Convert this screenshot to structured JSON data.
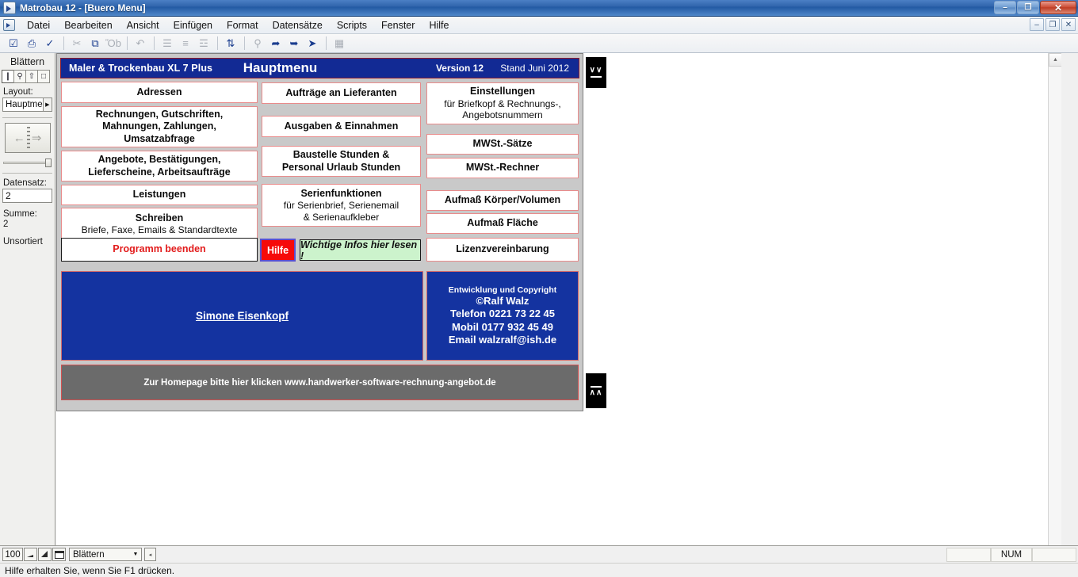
{
  "window": {
    "title": "Matrobau 12 - [Buero Menu]",
    "icon": "app-icon",
    "controls": [
      {
        "name": "minimize",
        "glyph": "–"
      },
      {
        "name": "restore",
        "glyph": "❐"
      },
      {
        "name": "close",
        "glyph": "✕"
      }
    ],
    "mdi_controls": [
      {
        "name": "mdi-minimize",
        "glyph": "–"
      },
      {
        "name": "mdi-restore",
        "glyph": "❐"
      },
      {
        "name": "mdi-close",
        "glyph": "✕"
      }
    ]
  },
  "menu": {
    "items": [
      {
        "label": "Datei"
      },
      {
        "label": "Bearbeiten"
      },
      {
        "label": "Ansicht"
      },
      {
        "label": "Einfügen"
      },
      {
        "label": "Format"
      },
      {
        "label": "Datensätze"
      },
      {
        "label": "Scripts"
      },
      {
        "label": "Fenster"
      },
      {
        "label": "Hilfe"
      }
    ]
  },
  "toolbar": {
    "buttons": [
      {
        "name": "new-record-icon",
        "glyph": "☑",
        "dim": false
      },
      {
        "name": "print-icon",
        "glyph": "⎙",
        "dim": false
      },
      {
        "name": "spellcheck-icon",
        "glyph": "✓",
        "dim": false
      },
      {
        "name": "cut-icon",
        "glyph": "✂",
        "dim": true
      },
      {
        "name": "copy-icon",
        "glyph": "⧉",
        "dim": false
      },
      {
        "name": "paste-icon",
        "glyph": "Ὄb",
        "dim": true
      },
      {
        "name": "undo-icon",
        "glyph": "↶",
        "dim": true
      },
      {
        "name": "find-all-icon",
        "glyph": "☰",
        "dim": true
      },
      {
        "name": "omit-record-icon",
        "glyph": "≡",
        "dim": true
      },
      {
        "name": "show-all-icon",
        "glyph": "☲",
        "dim": true
      },
      {
        "name": "sort-icon",
        "glyph": "⇅",
        "dim": false
      },
      {
        "name": "find-icon",
        "glyph": "⚲",
        "dim": true
      },
      {
        "name": "import-icon",
        "glyph": "➦",
        "dim": false
      },
      {
        "name": "export-icon",
        "glyph": "➥",
        "dim": false
      },
      {
        "name": "preview-icon",
        "glyph": "➤",
        "dim": false
      },
      {
        "name": "script-icon",
        "glyph": "▦",
        "dim": true
      }
    ]
  },
  "sidebar": {
    "title": "Blättern",
    "mode_buttons": [
      {
        "name": "browse-mode",
        "glyph": "❙",
        "active": true
      },
      {
        "name": "find-mode",
        "glyph": "⚲",
        "active": false
      },
      {
        "name": "preview-mode",
        "glyph": "⇧",
        "active": false
      },
      {
        "name": "layout-mode",
        "glyph": "□",
        "active": false
      }
    ],
    "layout_label": "Layout:",
    "layout_value": "Hauptme",
    "book": {
      "prev": "←",
      "next": "⇒"
    },
    "record_label": "Datensatz:",
    "record_value": "2",
    "total_label": "Summe:",
    "total_value": "2",
    "sort_state": "Unsortiert"
  },
  "layout": {
    "header": {
      "product": "Maler & Trockenbau XL 7 Plus",
      "title": "Hauptmenu",
      "version": "Version 12",
      "date": "Stand Juni 2012"
    },
    "left_buttons": [
      {
        "l1": "Adressen",
        "l2": ""
      },
      {
        "l1": "Rechnungen, Gutschriften,",
        "l2": "Mahnungen, Zahlungen,",
        "l3": "Umsatzabfrage",
        "multiline_bold": true
      },
      {
        "l1": "Angebote, Bestätigungen,",
        "l2": "Lieferscheine, Arbeitsaufträge",
        "multiline_bold": true
      },
      {
        "l1": "Leistungen",
        "l2": ""
      },
      {
        "l1": "Schreiben",
        "l2": "Briefe, Faxe, Emails & Standardtexte"
      }
    ],
    "exit_button": "Programm beenden",
    "middle_buttons": [
      {
        "l1": "Aufträge an Lieferanten",
        "l2": ""
      },
      {
        "l1": "Ausgaben & Einnahmen",
        "l2": ""
      },
      {
        "l1": "Baustelle Stunden &",
        "l2": "Personal Urlaub Stunden",
        "multiline_bold": true
      },
      {
        "l1": "Serienfunktionen",
        "l2": "für Serienbrief, Serienemail",
        "l3": "& Serienaufkleber"
      }
    ],
    "help_button": "Hilfe",
    "info_button": "Wichtige Infos hier lesen !",
    "right_buttons": [
      {
        "l1": "Einstellungen",
        "l2": "für Briefkopf & Rechnungs-,",
        "l3": "Angebotsnummern"
      },
      {
        "l1": "MWSt.-Sätze",
        "l2": ""
      },
      {
        "l1": "MWSt.-Rechner",
        "l2": ""
      },
      {
        "l1": "Aufmaß Körper/Volumen",
        "l2": ""
      },
      {
        "l1": "Aufmaß Fläche",
        "l2": ""
      },
      {
        "l1": "Lizenzvereinbarung",
        "l2": ""
      }
    ],
    "user_name": "Simone Eisenkopf",
    "developer": {
      "caption": "Entwicklung und Copyright",
      "lines": [
        "©Ralf Walz",
        "Telefon 0221 73 22 45",
        "Mobil 0177 932 45 49",
        "Email walzralf@ish.de"
      ]
    },
    "homepage_bar": "Zur Homepage bitte hier klicken www.handwerker-software-rechnung-angebot.de",
    "nav_chips": [
      {
        "name": "scroll-down-chip",
        "glyph": "∨∨",
        "bar_position": "below"
      },
      {
        "name": "scroll-up-chip",
        "glyph": "∧∧",
        "bar_position": "above"
      }
    ]
  },
  "statusbar": {
    "zoom": "100",
    "zoom_out_icon": "zoom-out-icon",
    "zoom_in_icon": "zoom-in-icon",
    "toggle_window_icon": "toggle-window-icon",
    "mode": "Blättern",
    "scroll_left_glyph": "◂",
    "cells": [
      "",
      "NUM",
      ""
    ],
    "message": "Hilfe erhalten Sie, wenn Sie F1 drücken."
  },
  "colors": {
    "title_bar_blue": "#2f64ab",
    "header_navy": "#122a94",
    "header_border": "#8e1b2d",
    "button_border_pink": "#e98b8b",
    "exit_red": "#e21b1b",
    "help_red": "#f60a0a",
    "help_border": "#5a4fd0",
    "info_green": "#ccf3cc",
    "panel_blue": "#1433a0",
    "homepage_gray": "#6b6b6b",
    "layout_bg": "#c9c9c9"
  }
}
